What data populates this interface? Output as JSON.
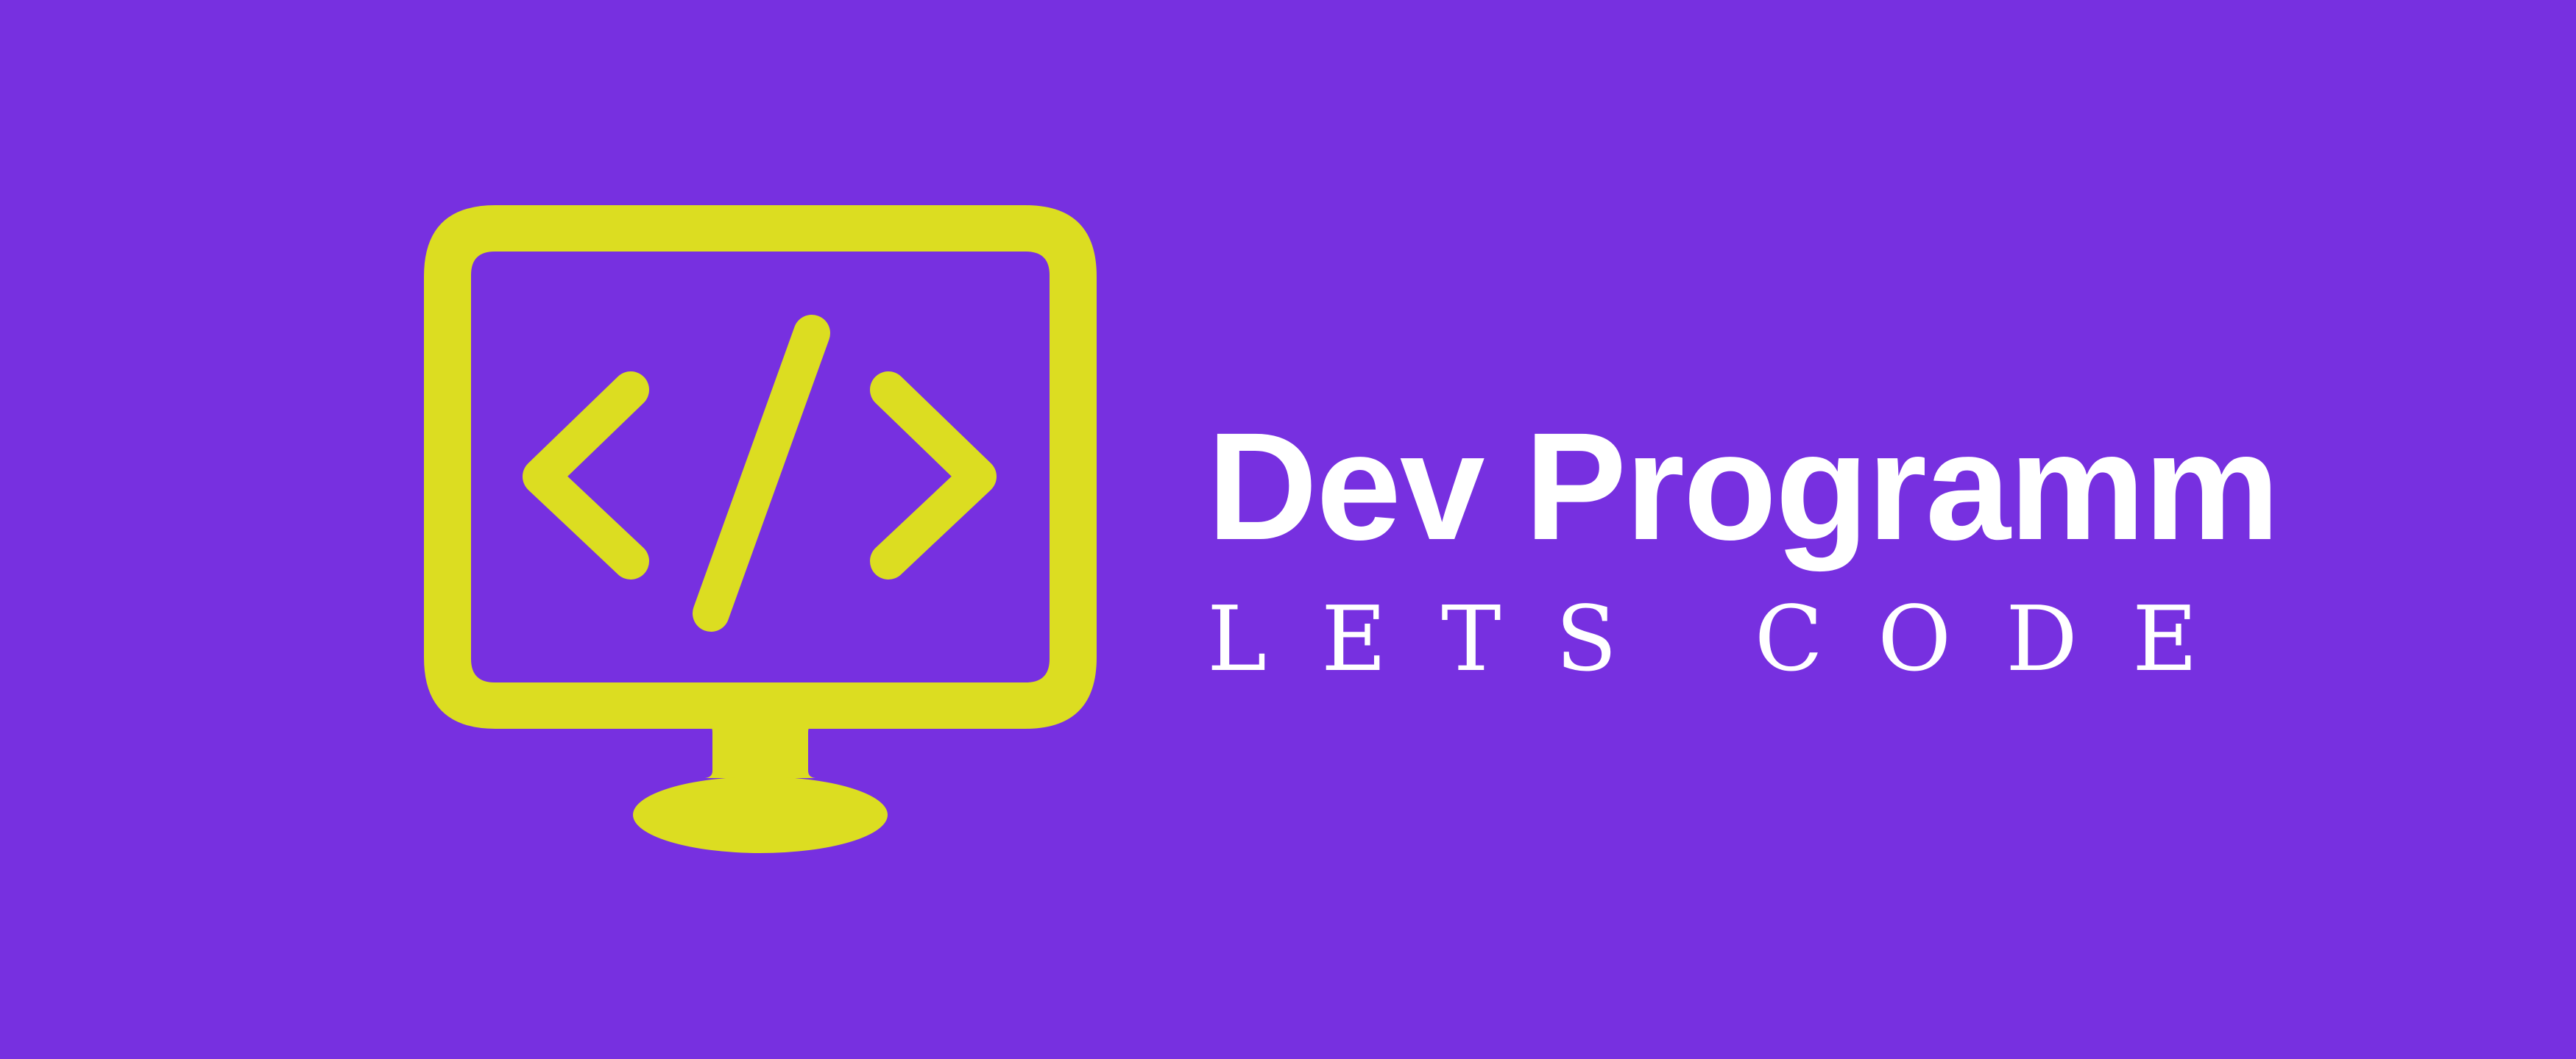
{
  "brand": {
    "title": "Dev Programm",
    "tagline": "LETS CODE"
  },
  "icons": {
    "monitor": "monitor-icon",
    "code": "code-brackets-icon"
  },
  "colors": {
    "background": "#7730e0",
    "accent": "#dcdd21",
    "text": "#ffffff"
  }
}
